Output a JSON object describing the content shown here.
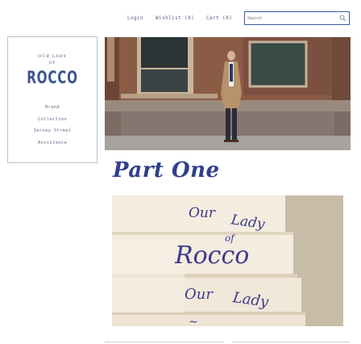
{
  "header": {
    "login_label": "Login",
    "wishlist_label": "Wishlist (0)",
    "cart_label": "Cart (0)",
    "search_placeholder": "Search",
    "search_icon": "search-icon"
  },
  "brand": {
    "top": "OUR LADY",
    "of": "OF",
    "name": "ROCCO"
  },
  "sidebar": {
    "items": [
      {
        "label": "Brand"
      },
      {
        "label": "Collection"
      },
      {
        "label": "Jersey Street"
      },
      {
        "label": "Assistance"
      }
    ]
  },
  "main": {
    "section_title": "Part One"
  },
  "colors": {
    "accent": "#2f3f8a",
    "brand": "#3b5591",
    "embroidery": "#3d3a8c"
  }
}
